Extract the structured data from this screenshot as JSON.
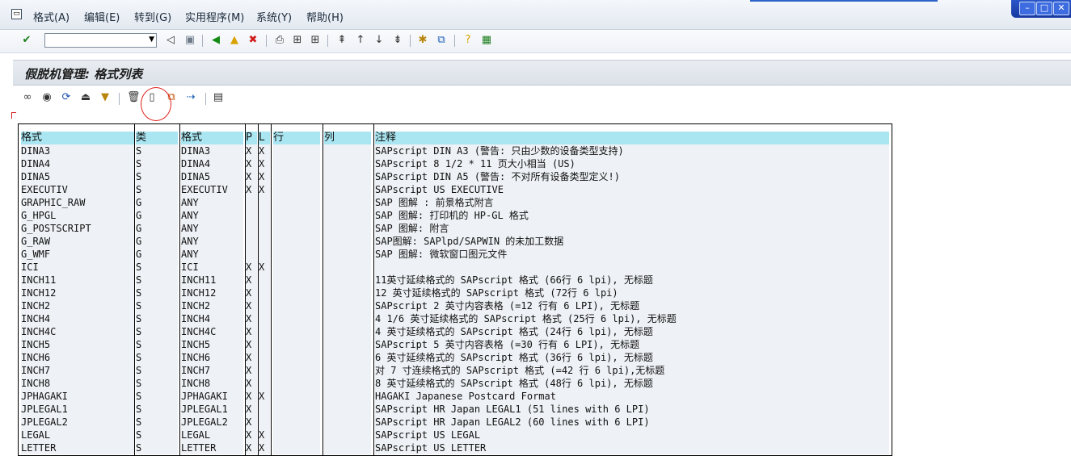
{
  "menubar": {
    "items": [
      "格式(A)",
      "编辑(E)",
      "转到(G)",
      "实用程序(M)",
      "系统(Y)",
      "帮助(H)"
    ]
  },
  "window_controls": [
    "minimize-icon",
    "maximize-icon",
    "close-icon"
  ],
  "standard_toolbar": {
    "command_field_value": "",
    "icons": [
      "enter-check-icon",
      "back-arrow-icon",
      "save-icon",
      "back-green-icon",
      "exit-yellow-icon",
      "cancel-red-icon",
      "print-icon",
      "find-icon",
      "find-next-icon",
      "first-page-icon",
      "previous-page-icon",
      "next-page-icon",
      "last-page-icon",
      "create-session-icon",
      "shortcut-icon",
      "help-icon",
      "layout-menu-icon"
    ]
  },
  "title": "假脱机管理: 格式列表",
  "app_toolbar": {
    "icons": [
      "glasses-display-icon",
      "choose-detail-icon",
      "refresh-icon",
      "print-list-icon",
      "filter-icon",
      "delete-icon",
      "create-icon",
      "copy-icon",
      "transport-icon",
      "documentation-icon"
    ]
  },
  "list": {
    "columns": [
      "格式",
      "类",
      "格式",
      "P",
      "L",
      "行",
      "列",
      "注释"
    ],
    "rows": [
      [
        "DINA3",
        "S",
        "DINA3",
        "X",
        "X",
        "",
        "",
        "SAPscript DIN A3 (警告: 只由少数的设备类型支持)"
      ],
      [
        "DINA4",
        "S",
        "DINA4",
        "X",
        "X",
        "",
        "",
        "SAPscript 8 1/2 * 11 页大小相当 (US)"
      ],
      [
        "DINA5",
        "S",
        "DINA5",
        "X",
        "X",
        "",
        "",
        "SAPscript DIN A5 (警告: 不对所有设备类型定义!)"
      ],
      [
        "EXECUTIV",
        "S",
        "EXECUTIV",
        "X",
        "X",
        "",
        "",
        "SAPscript US EXECUTIVE"
      ],
      [
        "GRAPHIC_RAW",
        "G",
        "ANY",
        "",
        "",
        "",
        "",
        "SAP 图解 : 前景格式附言"
      ],
      [
        "G_HPGL",
        "G",
        "ANY",
        "",
        "",
        "",
        "",
        "SAP 图解: 打印机的 HP-GL 格式"
      ],
      [
        "G_POSTSCRIPT",
        "G",
        "ANY",
        "",
        "",
        "",
        "",
        "SAP 图解: 附言"
      ],
      [
        "G_RAW",
        "G",
        "ANY",
        "",
        "",
        "",
        "",
        "SAP图解: SAPlpd/SAPWIN 的未加工数据"
      ],
      [
        "G_WMF",
        "G",
        "ANY",
        "",
        "",
        "",
        "",
        "SAP 图解: 微软窗口图元文件"
      ],
      [
        "ICI",
        "S",
        "ICI",
        "X",
        "X",
        "",
        "",
        ""
      ],
      [
        "INCH11",
        "S",
        "INCH11",
        "X",
        "",
        "",
        "",
        "11英寸延续格式的 SAPscript 格式 (66行 6 lpi), 无标题"
      ],
      [
        "INCH12",
        "S",
        "INCH12",
        "X",
        "",
        "",
        "",
        "12 英寸延续格式的 SAPscript 格式 (72行 6 lpi)"
      ],
      [
        "INCH2",
        "S",
        "INCH2",
        "X",
        "",
        "",
        "",
        "SAPscript 2 英寸内容表格 (=12 行有 6 LPI), 无标题"
      ],
      [
        "INCH4",
        "S",
        "INCH4",
        "X",
        "",
        "",
        "",
        "4 1/6 英寸延续格式的 SAPscript 格式 (25行 6 lpi), 无标题"
      ],
      [
        "INCH4C",
        "S",
        "INCH4C",
        "X",
        "",
        "",
        "",
        "4 英寸延续格式的 SAPscript 格式 (24行 6 lpi), 无标题"
      ],
      [
        "INCH5",
        "S",
        "INCH5",
        "X",
        "",
        "",
        "",
        "SAPscript 5 英寸内容表格 (=30 行有 6 LPI), 无标题"
      ],
      [
        "INCH6",
        "S",
        "INCH6",
        "X",
        "",
        "",
        "",
        "6 英寸延续格式的 SAPscript 格式 (36行 6 lpi), 无标题"
      ],
      [
        "INCH7",
        "S",
        "INCH7",
        "X",
        "",
        "",
        "",
        "对 7 寸连续格式的 SAPscript 格式 (=42 行 6 lpi),无标题"
      ],
      [
        "INCH8",
        "S",
        "INCH8",
        "X",
        "",
        "",
        "",
        "8 英寸延续格式的 SAPscript 格式 (48行 6 lpi), 无标题"
      ],
      [
        "JPHAGAKI",
        "S",
        "JPHAGAKI",
        "X",
        "X",
        "",
        "",
        "HAGAKI Japanese Postcard Format"
      ],
      [
        "JPLEGAL1",
        "S",
        "JPLEGAL1",
        "X",
        "",
        "",
        "",
        "SAPscript HR Japan LEGAL1 (51 lines with 6 LPI)"
      ],
      [
        "JPLEGAL2",
        "S",
        "JPLEGAL2",
        "X",
        "",
        "",
        "",
        "SAPscript HR Japan LEGAL2 (60 lines with 6 LPI)"
      ],
      [
        "LEGAL",
        "S",
        "LEGAL",
        "X",
        "X",
        "",
        "",
        "SAPscript US LEGAL"
      ],
      [
        "LETTER",
        "S",
        "LETTER",
        "X",
        "X",
        "",
        "",
        "SAPscript US LETTER"
      ]
    ]
  }
}
